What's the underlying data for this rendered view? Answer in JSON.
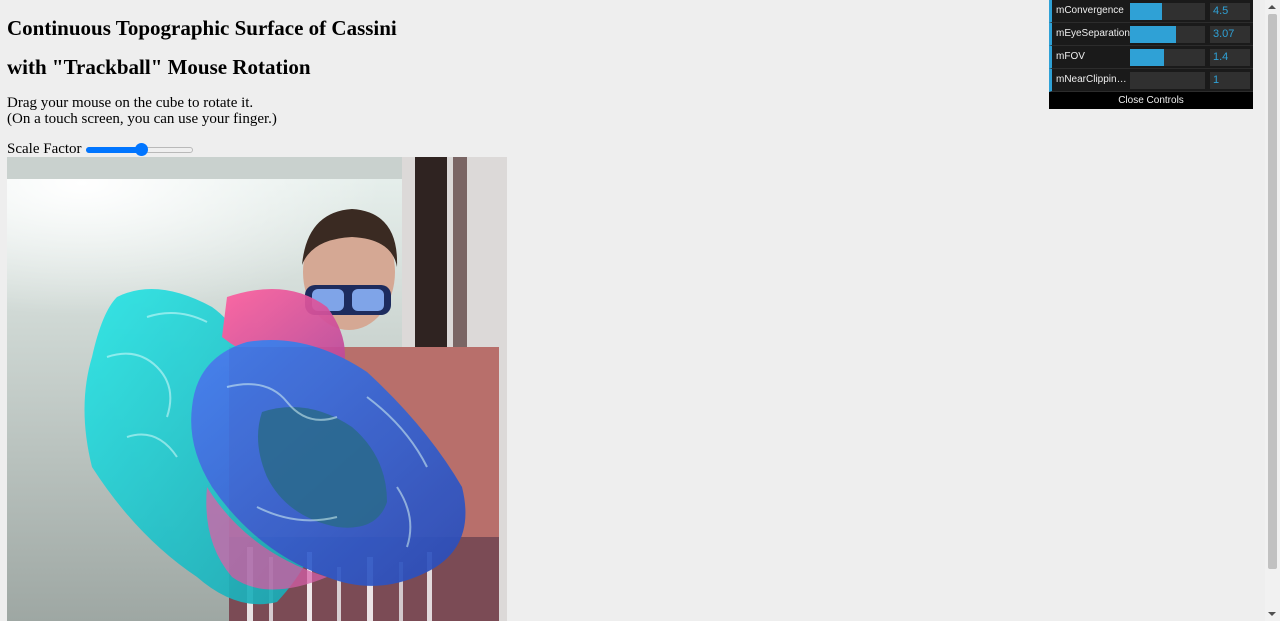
{
  "page": {
    "title_line1": "Continuous Topographic Surface of Cassini",
    "title_line2": "with \"Trackball\" Mouse Rotation",
    "instruction_line1": "Drag your mouse on the cube to rotate it.",
    "instruction_line2": "(On a touch screen, you can use your finger.)",
    "scale_label": "Scale Factor",
    "scale_value_fraction": 0.52
  },
  "controls": {
    "items": [
      {
        "label": "mConvergence",
        "value": "4.5",
        "fill": 0.43
      },
      {
        "label": "mEyeSeparation",
        "value": "3.07",
        "fill": 0.61
      },
      {
        "label": "mFOV",
        "value": "1.4",
        "fill": 0.45
      },
      {
        "label": "mNearClippingDistance",
        "value": "1",
        "fill": 0.0
      }
    ],
    "close_label": "Close Controls",
    "accent": "#2fa1d6"
  },
  "scene": {
    "description_icons": [
      "webcam-background",
      "torus-surface-cyan",
      "torus-surface-magenta"
    ]
  }
}
